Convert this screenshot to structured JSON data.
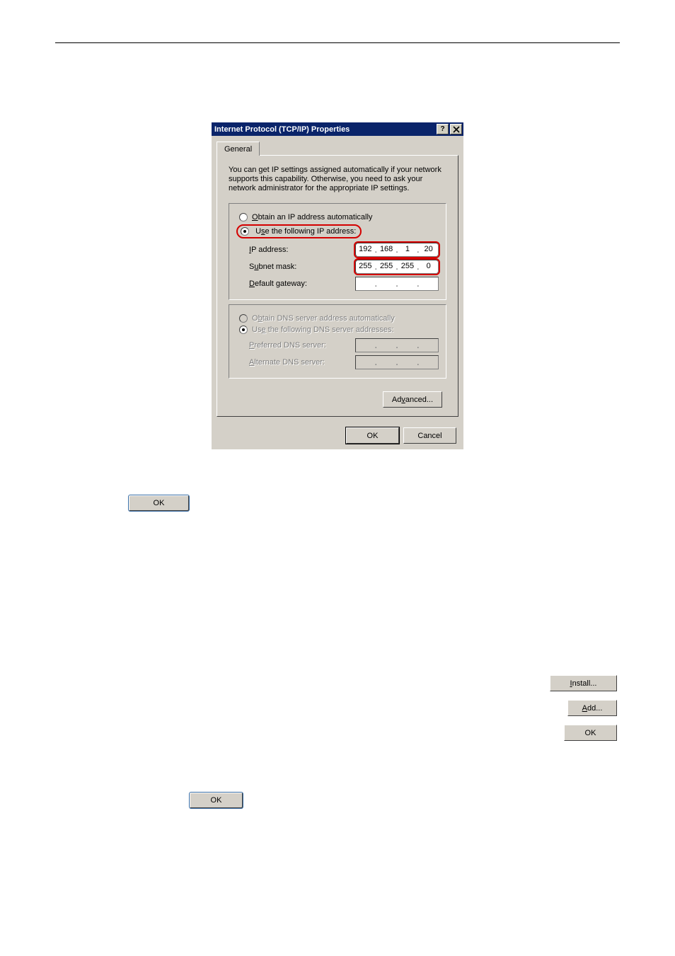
{
  "dialog": {
    "title": "Internet Protocol (TCP/IP) Properties",
    "tab_general": "General",
    "intro": "You can get IP settings assigned automatically if your network supports this capability. Otherwise, you need to ask your network administrator for the appropriate IP settings.",
    "ip": {
      "opt_auto": "Obtain an IP address automatically",
      "opt_manual": "Use the following IP address:",
      "label_ip": "IP address:",
      "label_subnet": "Subnet mask:",
      "label_gateway": "Default gateway:",
      "ip_value": [
        "192",
        "168",
        "1",
        "20"
      ],
      "subnet_value": [
        "255",
        "255",
        "255",
        "0"
      ],
      "gateway_value": [
        "",
        "",
        "",
        ""
      ]
    },
    "dns": {
      "opt_auto": "Obtain DNS server address automatically",
      "opt_manual": "Use the following DNS server addresses:",
      "label_pref": "Preferred DNS server:",
      "label_alt": "Alternate DNS server:"
    },
    "btn_advanced": "Advanced...",
    "btn_ok": "OK",
    "btn_cancel": "Cancel"
  },
  "buttons": {
    "install": "Install...",
    "add": "Add...",
    "ok": "OK",
    "ok2": "OK",
    "ok3": "OK"
  }
}
